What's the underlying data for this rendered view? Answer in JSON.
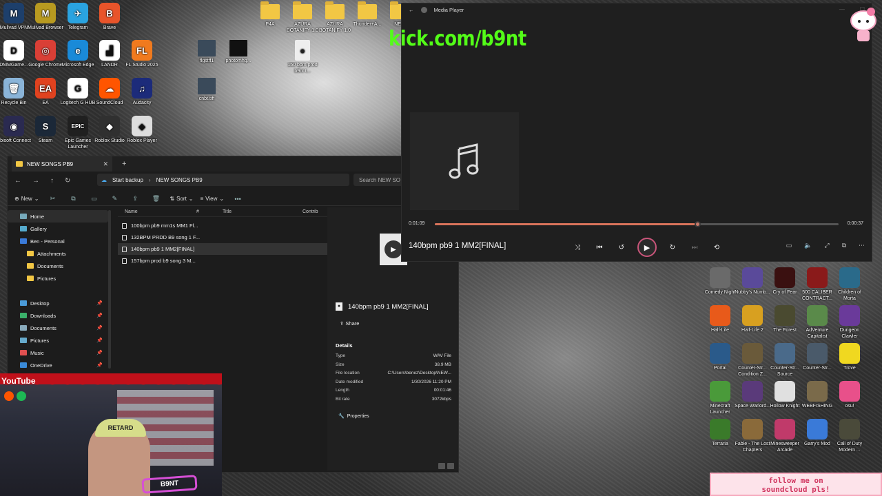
{
  "desktop_icons_left": [
    {
      "label": "Mullvad VPN",
      "color": "#1d3f6b",
      "glyph": "M"
    },
    {
      "label": "Mullvad Browser",
      "color": "#b89a20",
      "glyph": "M"
    },
    {
      "label": "Telegram",
      "color": "#2aa3e0",
      "glyph": "✈"
    },
    {
      "label": "Brave",
      "color": "#e8542a",
      "glyph": "B"
    },
    {
      "label": "DMMGame...",
      "color": "#ffffff",
      "glyph": "D"
    },
    {
      "label": "Google Chrome",
      "color": "#d93f36",
      "glyph": "◎"
    },
    {
      "label": "Microsoft Edge",
      "color": "#1a8ad8",
      "glyph": "e"
    },
    {
      "label": "LANDR",
      "color": "#ffffff",
      "glyph": "▟"
    },
    {
      "label": "FL Studio 2025",
      "color": "#f07a1e",
      "glyph": "FL"
    },
    {
      "label": "Recycle Bin",
      "color": "#8ab4d8",
      "glyph": "🗑"
    },
    {
      "label": "EA",
      "color": "#e0421f",
      "glyph": "EA"
    },
    {
      "label": "Logitech G HUB",
      "color": "#ffffff",
      "glyph": "G"
    },
    {
      "label": "SoundCloud",
      "color": "#ff5500",
      "glyph": "☁"
    },
    {
      "label": "Audacity",
      "color": "#1c2b7a",
      "glyph": "♫"
    },
    {
      "label": "Ubisoft Connect",
      "color": "#2a2a50",
      "glyph": "◉"
    },
    {
      "label": "Steam",
      "color": "#1b2838",
      "glyph": "S"
    },
    {
      "label": "Epic Games Launcher",
      "color": "#202020",
      "glyph": "EPIC"
    },
    {
      "label": "Roblox Studio",
      "color": "#303030",
      "glyph": "◆"
    },
    {
      "label": "Roblox Player",
      "color": "#dddddd",
      "glyph": "◆"
    }
  ],
  "desktop_icons_top": [
    {
      "label": "P4A",
      "type": "folder"
    },
    {
      "label": "AZURA BOTANIFY 1.0",
      "type": "folder"
    },
    {
      "label": "AZURA BOTANIFY 1.0",
      "type": "folder"
    },
    {
      "label": "Thunder+A...",
      "type": "folder"
    },
    {
      "label": "NE...",
      "type": "folder"
    },
    {
      "label": "flgstff1",
      "type": "image"
    },
    {
      "label": "photomhg...",
      "type": "image"
    },
    {
      "label": "150 bpm prod b9nt t...",
      "type": "audio"
    },
    {
      "label": "cnbt.tiff",
      "type": "image"
    }
  ],
  "desktop_icons_right": [
    "Comedy Night",
    "Nubby's Numb...",
    "Cry of Fear",
    "500 CALIBER CONTRACT...",
    "Children of Morta",
    "Half-Life",
    "Half-Life 2",
    "The Forest",
    "AdVenture Capitalist",
    "Dungeon Clawler",
    "Portal",
    "Counter-Str... Condition Z...",
    "Counter-Str... Source",
    "Counter-Str...",
    "Trove",
    "Minecraft Launcher",
    "Space Warlord...",
    "Hollow Knight",
    "WEBFISHING",
    "osu!",
    "Terraria",
    "Fable - The Lost Chapters",
    "Minesweeper Arcade",
    "Garry's Mod",
    "Call of Duty Modern ..."
  ],
  "explorer": {
    "tab_title": "NEW SONGS PB9",
    "breadcrumb": [
      "Start backup",
      "NEW SONGS PB9"
    ],
    "search_placeholder": "Search NEW SO",
    "toolbar": {
      "new": "New",
      "sort": "Sort",
      "view": "View"
    },
    "nav": [
      {
        "label": "Home",
        "selected": true
      },
      {
        "label": "Gallery"
      },
      {
        "label": "Ben - Personal"
      },
      {
        "label": "Attachments"
      },
      {
        "label": "Documents"
      },
      {
        "label": "Pictures"
      },
      {
        "label": "Desktop",
        "pinned": true
      },
      {
        "label": "Downloads",
        "pinned": true
      },
      {
        "label": "Documents",
        "pinned": true
      },
      {
        "label": "Pictures",
        "pinned": true
      },
      {
        "label": "Music",
        "pinned": true
      },
      {
        "label": "OneDrive",
        "pinned": true
      }
    ],
    "columns": [
      "Name",
      "#",
      "Title",
      "Contrib"
    ],
    "files": [
      {
        "name": "100bpm pb9 mm1s MM1 Fl...",
        "selected": false
      },
      {
        "name": "132BPM PRDD B9 song 1 F...",
        "selected": false
      },
      {
        "name": "140bpm pb9 1 MM2[FINAL]",
        "selected": true
      },
      {
        "name": "157bpm prod b9 song 3 M...",
        "selected": false
      }
    ],
    "details": {
      "title": "140bpm pb9 1 MM2[FINAL]",
      "share": "Share",
      "section": "Details",
      "rows": [
        {
          "k": "Type",
          "v": "WAV File"
        },
        {
          "k": "Size",
          "v": "38.9 MB"
        },
        {
          "k": "File location",
          "v": "C:\\Users\\benez\\Desktop\\NEW..."
        },
        {
          "k": "Date modified",
          "v": "1/30/2026 11:20 PM"
        },
        {
          "k": "Length",
          "v": "00:01:46"
        },
        {
          "k": "Bit rate",
          "v": "3072kbps"
        }
      ],
      "properties": "Properties"
    }
  },
  "player": {
    "app_title": "Media Player",
    "overlay_text": "kick.com/b9nt",
    "elapsed": "0:01:09",
    "remaining": "0:00:37",
    "progress": 0.65,
    "track_title": "140bpm pb9 1 MM2[FINAL]"
  },
  "stream": {
    "youtube": "YouTube",
    "cap_text": "RETARD",
    "tag_text": "B9NT"
  },
  "banner": {
    "line1": "follow me on",
    "line2": "soundcloud pls!"
  }
}
